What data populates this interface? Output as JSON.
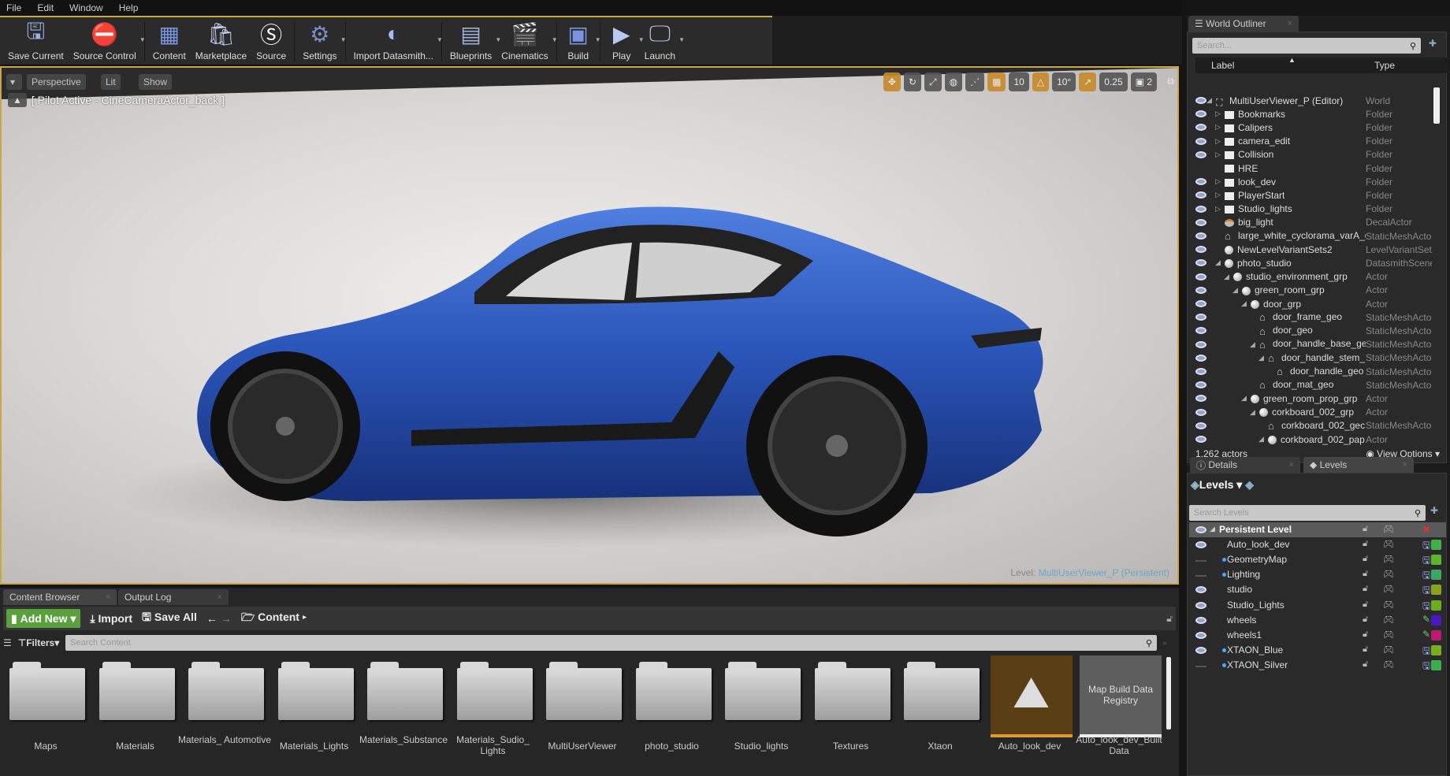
{
  "menu": [
    "File",
    "Edit",
    "Window",
    "Help"
  ],
  "toolbar": [
    {
      "label": "Save Current",
      "icon": "save-icon",
      "dd": false
    },
    {
      "label": "Source Control",
      "icon": "source-control-icon",
      "dd": true
    },
    {
      "label": "Content",
      "icon": "content-icon",
      "dd": false
    },
    {
      "label": "Marketplace",
      "icon": "marketplace-icon",
      "dd": false
    },
    {
      "label": "Source",
      "icon": "source-icon",
      "dd": false
    },
    {
      "label": "Settings",
      "icon": "settings-icon",
      "dd": true
    },
    {
      "label": "Import Datasmith...",
      "icon": "datasmith-icon",
      "dd": true
    },
    {
      "label": "Blueprints",
      "icon": "blueprints-icon",
      "dd": true
    },
    {
      "label": "Cinematics",
      "icon": "cinematics-icon",
      "dd": true
    },
    {
      "label": "Build",
      "icon": "build-icon",
      "dd": true
    },
    {
      "label": "Play",
      "icon": "play-icon",
      "dd": true
    },
    {
      "label": "Launch",
      "icon": "launch-icon",
      "dd": true
    }
  ],
  "viewport": {
    "perspective": "Perspective",
    "lit": "Lit",
    "show": "Show",
    "pilot": "[ Pilot Active - CineCameraActor_back ]",
    "grid_snap": "10",
    "rot_snap": "10°",
    "scale_snap": "0.25",
    "camera_speed": "2",
    "level_label": "Level:",
    "level_name": "MultiUserViewer_P (Persistent)",
    "car_color": "#2a55b8"
  },
  "content_browser": {
    "tabs": [
      "Content Browser",
      "Output Log"
    ],
    "add_new": "Add New",
    "import": "Import",
    "save_all": "Save All",
    "path": "Content",
    "filters": "Filters",
    "search_placeholder": "Search Content",
    "assets": [
      {
        "name": "Maps",
        "kind": "folder"
      },
      {
        "name": "Materials",
        "kind": "folder"
      },
      {
        "name": "Materials_ Automotive",
        "kind": "folder"
      },
      {
        "name": "Materials_Lights",
        "kind": "folder"
      },
      {
        "name": "Materials_Substance",
        "kind": "folder"
      },
      {
        "name": "Materials_Sudio_ Lights",
        "kind": "folder"
      },
      {
        "name": "MultiUserViewer",
        "kind": "folder"
      },
      {
        "name": "photo_studio",
        "kind": "folder"
      },
      {
        "name": "Studio_lights",
        "kind": "folder"
      },
      {
        "name": "Textures",
        "kind": "folder"
      },
      {
        "name": "Xtaon",
        "kind": "folder"
      },
      {
        "name": "Auto_look_dev",
        "kind": "level"
      },
      {
        "name": "Auto_look_dev_Built Data",
        "kind": "builtdata",
        "thumb": "Map Build Data Registry"
      }
    ]
  },
  "outliner": {
    "tab": "World Outliner",
    "search_placeholder": "Search...",
    "col_label": "Label",
    "col_type": "Type",
    "rows": [
      {
        "label": "MultiUserViewer_P (Editor)",
        "type": "World",
        "indent": 0,
        "exp": "open",
        "icon": "world"
      },
      {
        "label": "Bookmarks",
        "type": "Folder",
        "indent": 1,
        "exp": "closed",
        "icon": "folder"
      },
      {
        "label": "Calipers",
        "type": "Folder",
        "indent": 1,
        "exp": "closed",
        "icon": "folder"
      },
      {
        "label": "camera_edit",
        "type": "Folder",
        "indent": 1,
        "exp": "closed",
        "icon": "folder"
      },
      {
        "label": "Collision",
        "type": "Folder",
        "indent": 1,
        "exp": "closed",
        "icon": "folder"
      },
      {
        "label": "HRE",
        "type": "Folder",
        "indent": 1,
        "exp": "",
        "icon": "folder",
        "hidden": true
      },
      {
        "label": "look_dev",
        "type": "Folder",
        "indent": 1,
        "exp": "closed",
        "icon": "folder"
      },
      {
        "label": "PlayerStart",
        "type": "Folder",
        "indent": 1,
        "exp": "closed",
        "icon": "folder"
      },
      {
        "label": "Studio_lights",
        "type": "Folder",
        "indent": 1,
        "exp": "closed",
        "icon": "folder"
      },
      {
        "label": "big_light",
        "type": "DecalActor",
        "indent": 1,
        "exp": "",
        "icon": "decal"
      },
      {
        "label": "large_white_cyclorama_varA_g",
        "type": "StaticMeshActor",
        "indent": 1,
        "exp": "",
        "icon": "mesh"
      },
      {
        "label": "NewLevelVariantSets2",
        "type": "LevelVariantSets",
        "indent": 1,
        "exp": "",
        "icon": "sphere"
      },
      {
        "label": "photo_studio",
        "type": "DatasmithScene",
        "indent": 1,
        "exp": "open",
        "icon": "sphere"
      },
      {
        "label": "studio_environment_grp",
        "type": "Actor",
        "indent": 2,
        "exp": "open",
        "icon": "sphere"
      },
      {
        "label": "green_room_grp",
        "type": "Actor",
        "indent": 3,
        "exp": "open",
        "icon": "sphere"
      },
      {
        "label": "door_grp",
        "type": "Actor",
        "indent": 4,
        "exp": "open",
        "icon": "sphere"
      },
      {
        "label": "door_frame_geo",
        "type": "StaticMeshActor",
        "indent": 5,
        "exp": "",
        "icon": "mesh"
      },
      {
        "label": "door_geo",
        "type": "StaticMeshActor",
        "indent": 5,
        "exp": "",
        "icon": "mesh"
      },
      {
        "label": "door_handle_base_ge",
        "type": "StaticMeshActor",
        "indent": 5,
        "exp": "open",
        "icon": "mesh"
      },
      {
        "label": "door_handle_stem_",
        "type": "StaticMeshActor",
        "indent": 6,
        "exp": "open",
        "icon": "mesh"
      },
      {
        "label": "door_handle_geo",
        "type": "StaticMeshActor",
        "indent": 7,
        "exp": "",
        "icon": "mesh"
      },
      {
        "label": "door_mat_geo",
        "type": "StaticMeshActor",
        "indent": 5,
        "exp": "",
        "icon": "mesh"
      },
      {
        "label": "green_room_prop_grp",
        "type": "Actor",
        "indent": 4,
        "exp": "open",
        "icon": "sphere"
      },
      {
        "label": "corkboard_002_grp",
        "type": "Actor",
        "indent": 5,
        "exp": "open",
        "icon": "sphere"
      },
      {
        "label": "corkboard_002_gec",
        "type": "StaticMeshActor",
        "indent": 6,
        "exp": "",
        "icon": "mesh"
      },
      {
        "label": "corkboard_002_pap",
        "type": "Actor",
        "indent": 6,
        "exp": "open",
        "icon": "sphere"
      }
    ],
    "count": "1,262 actors",
    "view_options": "View Options"
  },
  "levels_panel": {
    "tabs": [
      "Details",
      "Levels"
    ],
    "title": "Levels",
    "search_placeholder": "Search Levels",
    "rows": [
      {
        "label": "Persistent Level",
        "visible": true,
        "dot": false,
        "persistent": true
      },
      {
        "label": "Auto_look_dev",
        "visible": true,
        "dot": false,
        "save": "save",
        "color": "#3fb04a"
      },
      {
        "label": "GeometryMap",
        "visible": false,
        "dot": true,
        "save": "save",
        "color": "#5ab52a"
      },
      {
        "label": "Lighting",
        "visible": false,
        "dot": true,
        "save": "save",
        "color": "#3aa860"
      },
      {
        "label": "studio",
        "visible": true,
        "dot": false,
        "save": "save",
        "color": "#8aa21e"
      },
      {
        "label": "Studio_Lights",
        "visible": true,
        "dot": false,
        "save": "save",
        "color": "#6aae1e"
      },
      {
        "label": "wheels",
        "visible": true,
        "dot": false,
        "save": "pencil",
        "color": "#4a18c0"
      },
      {
        "label": "wheels1",
        "visible": true,
        "dot": false,
        "save": "pencil",
        "color": "#c01870"
      },
      {
        "label": "XTAON_Blue",
        "visible": true,
        "dot": true,
        "save": "save",
        "color": "#7aae1e"
      },
      {
        "label": "XTAON_Silver",
        "visible": false,
        "dot": true,
        "save": "save",
        "color": "#3aae48"
      }
    ]
  }
}
